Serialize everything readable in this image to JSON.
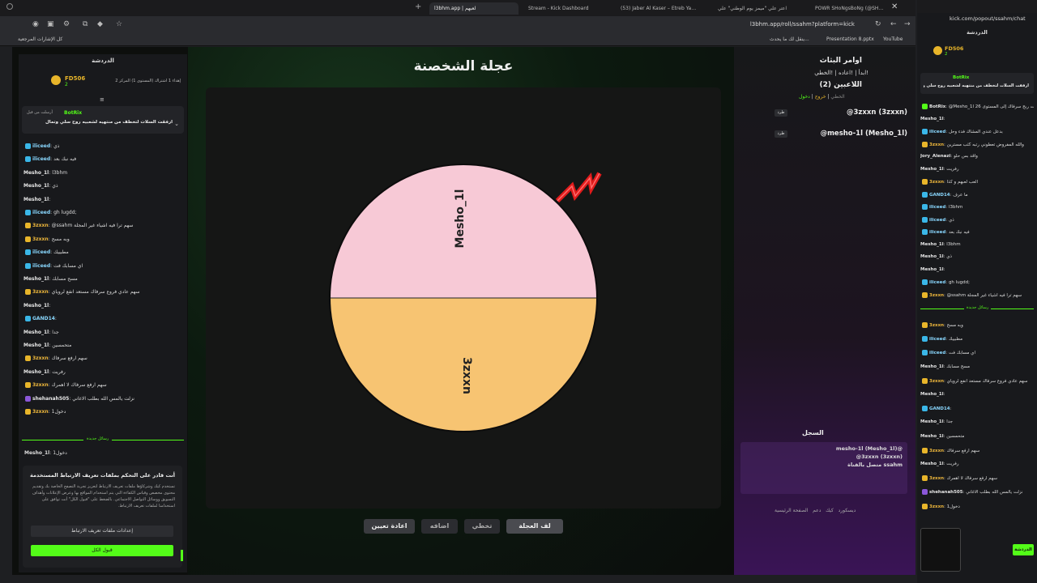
{
  "browser": {
    "tabs": [
      {
        "label": "POWR SHoNgsBoNg (@SH…"
      },
      {
        "label": "اعتر علي \"ميمز يوم الوطني\" علي"
      },
      {
        "label": "(53) Jaber Al Kaser – Etreb Ya…"
      },
      {
        "label": "Stream - Kick Dashboard"
      },
      {
        "label": "l3bhm.app | لعبهم"
      }
    ],
    "url": "l3bhm.app/roll/ssahm?platform=kick",
    "bookmarks_all": "كل الإشارات المرجعية",
    "bookmarks": [
      "ينقل لك ما يحدث...",
      "Presentation 8.pptx",
      "YouTube"
    ]
  },
  "left_chat": {
    "header": "الدردشة",
    "top_user": "FD506",
    "top_user_count": "2",
    "top_user_note": "إهداء 1 اشتراك (المستوى 1) المركز 2",
    "pinned_by": "أرسلت من قبل",
    "pinned_user": "BotRix",
    "pinned_text": "ارفقت السلات لتخطف من منتهيه لشعبيه روح سلي وتمال",
    "messages": [
      {
        "user": "iliceed",
        "text": "ذي"
      },
      {
        "user": "iliceed",
        "text": "فيه نبك بعد"
      },
      {
        "user": "Mesho_1l",
        "text": "l3bhm"
      },
      {
        "user": "Mesho_1l",
        "text": "ذي"
      },
      {
        "user": "Mesho_1l",
        "text": ""
      },
      {
        "user": "iliceed",
        "text": "gh lugdd;"
      },
      {
        "user": "3zxxn",
        "text": "@ssahm سهم ترا فيه اشياء غير المجلة"
      },
      {
        "user": "3zxxn",
        "text": "وبه مسح"
      },
      {
        "user": "iliceed",
        "text": "مطبييك"
      },
      {
        "user": "iliceed",
        "text": "اي مسابك فت"
      },
      {
        "user": "Mesho_1l",
        "text": "مسح مسابك"
      },
      {
        "user": "3zxxn",
        "text": "سهم عادي فروع سرفاك مستعد انفع لروياي"
      },
      {
        "user": "Mesho_1l",
        "text": ""
      },
      {
        "user": "GAND14",
        "text": ""
      },
      {
        "user": "Mesho_1l",
        "text": "جدا"
      },
      {
        "user": "Mesho_1l",
        "text": "متحمسين"
      },
      {
        "user": "3zxxn",
        "text": "سهم ارفع سرفاك"
      },
      {
        "user": "Mesho_1l",
        "text": "رفريت"
      },
      {
        "user": "3zxxn",
        "text": "سهم ارفع سرفاك لا اهمرك"
      },
      {
        "user": "shehanah505",
        "text": "نزلت يالمس الله بطلب الاغاني"
      },
      {
        "user": "3zxxn",
        "text": "دخول1"
      }
    ],
    "new_messages": "رسائل جديدة",
    "last_message": {
      "user": "Mesho_1l",
      "text": "دخول1"
    },
    "cookie_title": "أنت قادر على التحكم بملفات تعريف الارتباط المستخدمة",
    "cookie_text": "تستخدم كيك وشركاؤها ملفات تعريف الارتباط لتعزيز تجربة التصفح الخاصة بك وتقديم محتوى مخصص وقياس الكفاءة التي يتم استخدام المواقع بها وعرض الإعلانات وأهداف التسويق ووسائل التواصل الاجتماعي. بالضغط على \"قبول الكل\" أنت توافق على استخدامنا لملفات تعريف الارتباط.",
    "cookie_settings": "إعدادات ملفات تعريف الارتباط",
    "cookie_accept": "قبول الكل"
  },
  "game": {
    "title": "عجلة الشخصنة",
    "segments": [
      {
        "label": "Mesho_1l",
        "color": "#f7c9d6"
      },
      {
        "label": "3zxxn",
        "color": "#f7c472"
      }
    ],
    "buttons": {
      "spin": "لف العجلة",
      "skip": "تخطي",
      "add": "اضافه",
      "reset": "اعادة تعيين"
    }
  },
  "right_panel": {
    "commands_title": "اوامر البثاث",
    "commands_line": "!ابدأ | !اعاده | !الخطي",
    "players_title": "اللاعبين (2)",
    "links": [
      "دخول",
      "خروج",
      "الخطي"
    ],
    "players": [
      {
        "name": "@3zxxn (3zxxn)",
        "kick": "طرد"
      },
      {
        "name": "@mesho-1l (Mesho_1l)",
        "kick": "طرد"
      }
    ],
    "log_title": "السجل",
    "log": [
      "mesho-1l (Mesho_1l)@",
      "@3zxxn (3zxxn)",
      "متصل بالقناة ssahm"
    ],
    "footer_links": [
      "الصفحة الرئيسية",
      "دعم",
      "كيك",
      "ديسكورد"
    ]
  },
  "popout": {
    "url": "kick.com/popout/ssahm/chat",
    "header": "الدردشة",
    "top_user": "FD506",
    "top_user_count": "2",
    "pinned_user": "BotRix",
    "pinned_text": "ارفقت السلات لتخطف من منتهيه لشعبيه روح سلي وتمال",
    "messages": [
      {
        "user": "BotRix",
        "text": "@Mesho_1l فت ربح سرفاك إلى المستوى 26"
      },
      {
        "user": "Mesho_1l",
        "text": ""
      },
      {
        "user": "iliceed",
        "text": "بدعل عندي المشاك فدء وحل"
      },
      {
        "user": "3zxxn",
        "text": "والله المفروض تعطوني رتبه كثب مسترين"
      },
      {
        "user": "Jory_Alenazi",
        "text": "واقد بس حلو"
      },
      {
        "user": "Mesho_1l",
        "text": "رفريت"
      },
      {
        "user": "3zxxn",
        "text": "العب لعبهم و كذا"
      },
      {
        "user": "GAND14",
        "text": "ما عرف"
      },
      {
        "user": "iliceed",
        "text": "l3bhm"
      },
      {
        "user": "iliceed",
        "text": "ذي"
      },
      {
        "user": "iliceed",
        "text": "فيه نبك بعد"
      },
      {
        "user": "Mesho_1l",
        "text": "l3bhm"
      },
      {
        "user": "Mesho_1l",
        "text": "ذي"
      },
      {
        "user": "Mesho_1l",
        "text": ""
      },
      {
        "user": "iliceed",
        "text": "gh lugdd;"
      },
      {
        "user": "3zxxn",
        "text": "@ssahm سهم ترا فيه اشياء غير المجلة"
      }
    ],
    "new_messages": "رسائل جديدة",
    "messages2": [
      {
        "user": "3zxxn",
        "text": "وبه مسح"
      },
      {
        "user": "iliceed",
        "text": "مطبييك"
      },
      {
        "user": "iliceed",
        "text": "اي مسابك فت"
      },
      {
        "user": "Mesho_1l",
        "text": "مسح مسابك"
      },
      {
        "user": "3zxxn",
        "text": "سهم عادي فروع سرفاك مستعد انفع لروياي"
      },
      {
        "user": "Mesho_1l",
        "text": ""
      },
      {
        "user": "GAND14",
        "text": ""
      },
      {
        "user": "Mesho_1l",
        "text": "جدا"
      },
      {
        "user": "Mesho_1l",
        "text": "متحمسين"
      },
      {
        "user": "3zxxn",
        "text": "سهم ارفع سرفاك"
      },
      {
        "user": "Mesho_1l",
        "text": "رفريت"
      },
      {
        "user": "3zxxn",
        "text": "سهم ارفع سرفاك لا اهمرك"
      },
      {
        "user": "shehanah505",
        "text": "نزلت يالمس الله بطلب الاغاني"
      },
      {
        "user": "3zxxn",
        "text": "دخول1"
      }
    ],
    "send": "الدردشة"
  }
}
